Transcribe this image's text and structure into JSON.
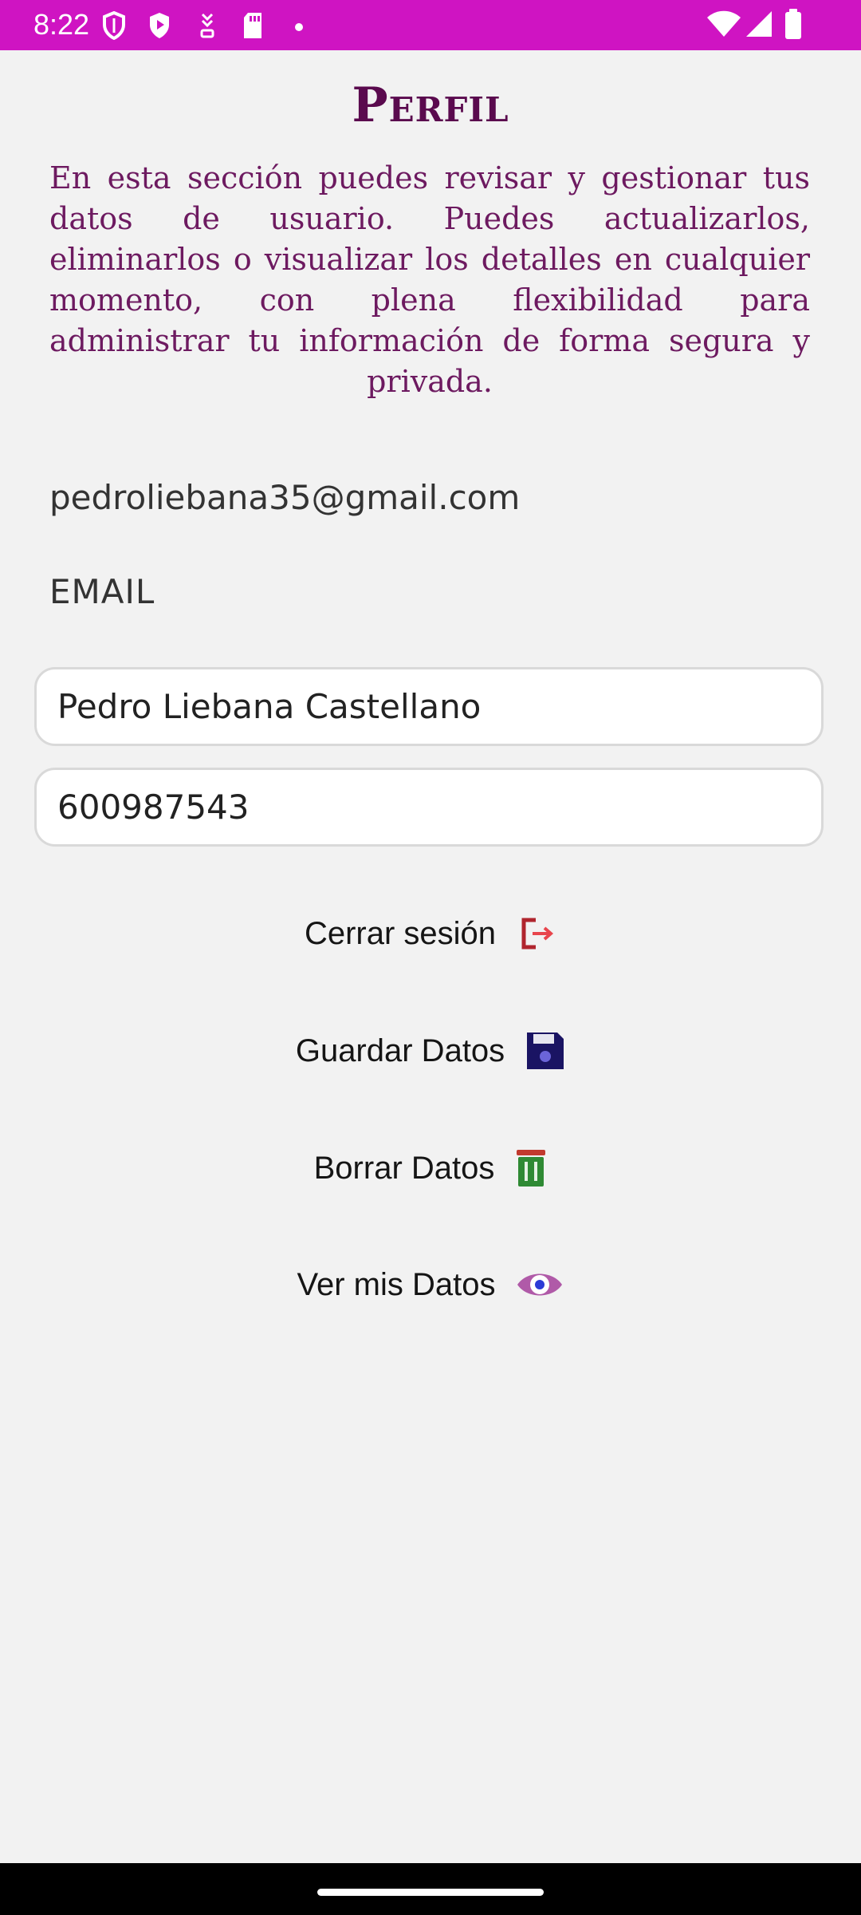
{
  "status_bar": {
    "time": "8:22",
    "background_color": "#cf14c2",
    "left_icons": [
      "shield-icon",
      "play-protect-icon",
      "download-icon",
      "sd-card-icon",
      "notification-dot-icon"
    ],
    "right_icons": [
      "wifi-icon",
      "cell-signal-icon",
      "battery-icon"
    ]
  },
  "header": {
    "title": "Perfil",
    "title_color": "#5a0a4e"
  },
  "description": "En esta sección puedes revisar y gestionar tus datos de usuario. Puedes actualizarlos, eliminarlos o visualizar los detalles en cualquier momento, con plena flexibilidad para administrar tu información de forma segura y privada.",
  "profile": {
    "email_value": "pedroliebana35@gmail.com",
    "email_label": "EMAIL",
    "name_value": "Pedro Liebana Castellano",
    "phone_value": "600987543"
  },
  "actions": {
    "logout_label": "Cerrar sesión",
    "logout_icon": "logout-icon",
    "save_label": "Guardar Datos",
    "save_icon": "floppy-disk-icon",
    "delete_label": "Borrar Datos",
    "delete_icon": "trash-icon",
    "view_label": "Ver mis Datos",
    "view_icon": "eye-icon"
  }
}
